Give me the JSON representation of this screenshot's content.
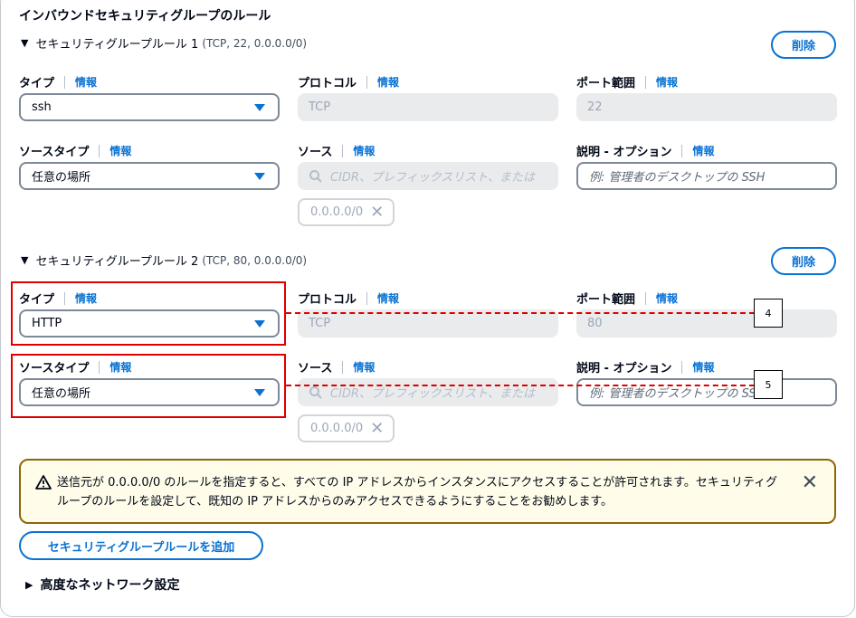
{
  "section_title": "インバウンドセキュリティグループのルール",
  "info": "情報",
  "rules": [
    {
      "title": "セキュリティグループルール 1",
      "meta": "(TCP, 22, 0.0.0.0/0)",
      "delete_label": "削除",
      "type_label": "タイプ",
      "type_value": "ssh",
      "protocol_label": "プロトコル",
      "protocol_value": "TCP",
      "port_label": "ポート範囲",
      "port_value": "22",
      "source_type_label": "ソースタイプ",
      "source_type_value": "任意の場所",
      "source_label": "ソース",
      "source_placeholder": "CIDR、プレフィックスリスト、または",
      "source_token": "0.0.0.0/0",
      "desc_label": "説明 - オプション",
      "desc_placeholder": "例: 管理者のデスクトップの SSH"
    },
    {
      "title": "セキュリティグループルール 2",
      "meta": "(TCP, 80, 0.0.0.0/0)",
      "delete_label": "削除",
      "type_label": "タイプ",
      "type_value": "HTTP",
      "protocol_label": "プロトコル",
      "protocol_value": "TCP",
      "port_label": "ポート範囲",
      "port_value": "80",
      "source_type_label": "ソースタイプ",
      "source_type_value": "任意の場所",
      "source_label": "ソース",
      "source_placeholder": "CIDR、プレフィックスリスト、または",
      "source_token": "0.0.0.0/0",
      "desc_label": "説明 - オプション",
      "desc_placeholder": "例: 管理者のデスクトップの SSH"
    }
  ],
  "callouts": [
    "4",
    "5"
  ],
  "alert": {
    "text": "送信元が 0.0.0.0/0 のルールを指定すると、すべての IP アドレスからインスタンスにアクセスすることが許可されます。セキュリティグループのルールを設定して、既知の IP アドレスからのみアクセスできるようにすることをお勧めします。"
  },
  "add_rule_label": "セキュリティグループルールを追加",
  "advanced_label": "高度なネットワーク設定",
  "colors": {
    "accent": "#0972d3",
    "highlight": "#e00000",
    "warning_border": "#8d6605"
  }
}
